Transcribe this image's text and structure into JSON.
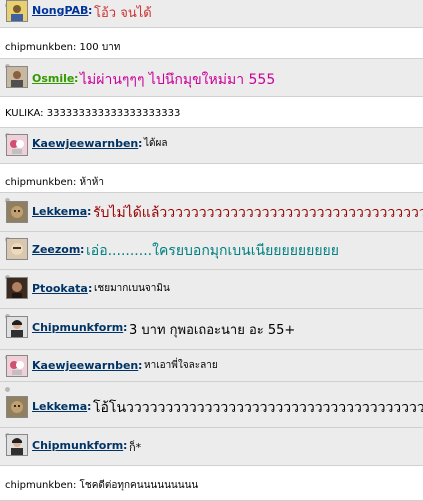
{
  "messages": [
    {
      "type": "user",
      "name": "NongPAB",
      "text": "โอ้ว จนได้",
      "name_color": "#003399",
      "text_color": "#cc3333",
      "avatar_icon": "yellow-avatar-icon"
    },
    {
      "type": "system",
      "text": "chipmunkben: 100 บาท"
    },
    {
      "type": "user",
      "name": "Osmile",
      "text": "ไม่ผ่านๆๆๆ ไปนึกมุขใหม่มา 555",
      "name_color": "#339900",
      "text_color": "#cc0099",
      "avatar_icon": "photo-avatar-icon"
    },
    {
      "type": "system",
      "text": "KULIKA: 333333333333333333333"
    },
    {
      "type": "user",
      "name": "Kaewjeewarnben",
      "text": "ได้ผล",
      "name_color": "#003366",
      "text_color": "#000000",
      "avatar_icon": "cartoon-avatar-icon"
    },
    {
      "type": "system",
      "text": "chipmunkben: ห้าห้า"
    },
    {
      "type": "user",
      "name": "Lekkema",
      "text": "รับไม่ได้แล้วววววววววววววววววววววววววววววววววววววววววววว",
      "name_color": "#003366",
      "text_color": "#990000",
      "avatar_icon": "animal-avatar-icon"
    },
    {
      "type": "user",
      "name": "Zeezom",
      "text": "เอ่อ..........ใครยบอกมุกเบนเนียยยยยยยยย",
      "name_color": "#003366",
      "text_color": "#008080",
      "avatar_icon": "face-avatar-icon"
    },
    {
      "type": "user",
      "name": "Ptookata",
      "text": "เชยมากเบนจามิน",
      "name_color": "#003366",
      "text_color": "#000000",
      "avatar_icon": "dark-avatar-icon"
    },
    {
      "type": "user",
      "name": "Chipmunkform",
      "text": "3 บาท กุพอเถอะนาย อะ 55+",
      "name_color": "#003366",
      "text_color": "#000000",
      "avatar_icon": "person-avatar-icon"
    },
    {
      "type": "user",
      "name": "Kaewjeewarnben",
      "text": "หาเอาพี่ใจละลาย",
      "name_color": "#003366",
      "text_color": "#000000",
      "avatar_icon": "cartoon-avatar-icon"
    },
    {
      "type": "user",
      "name": "Lekkema",
      "text": "โอ้โนววววววววววววววววววววววววววววววววววววววววววววววว",
      "name_color": "#003366",
      "text_color": "#000000",
      "avatar_icon": "animal-avatar-icon"
    },
    {
      "type": "user",
      "name": "Chipmunkform",
      "text": "ก็*",
      "name_color": "#003366",
      "text_color": "#000000",
      "avatar_icon": "person-avatar-icon"
    },
    {
      "type": "system",
      "text": "chipmunkben: โชคดีต่อทุกคนนนนนนนนน"
    }
  ]
}
